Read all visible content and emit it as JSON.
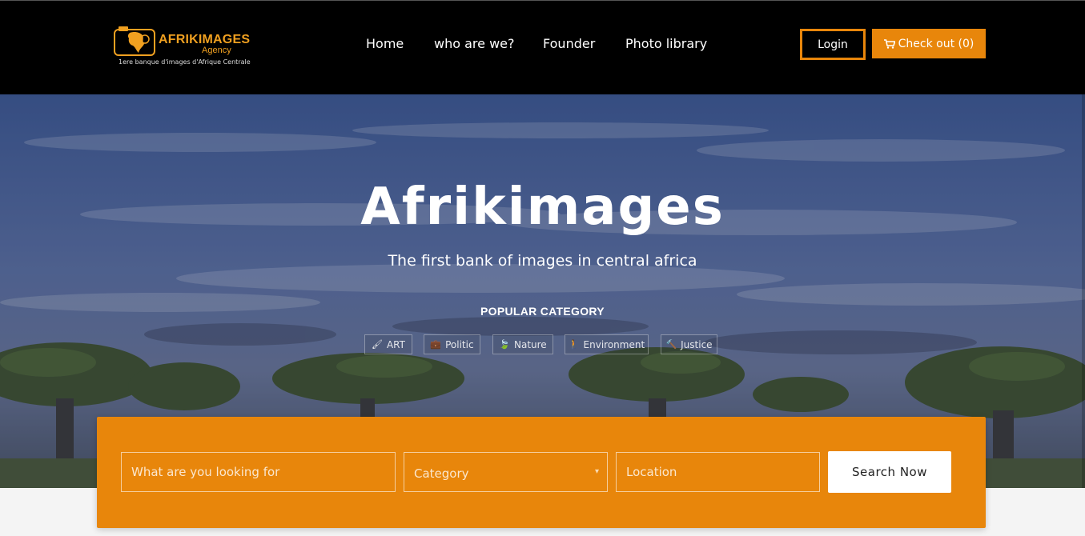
{
  "header": {
    "logo": {
      "title": "AFRIKIMAGES",
      "subtitle": "Agency",
      "tagline": "1ere banque d'images d'Afrique Centrale"
    },
    "nav": [
      {
        "label": "Home"
      },
      {
        "label": "who are we?"
      },
      {
        "label": "Founder"
      },
      {
        "label": "Photo library"
      }
    ],
    "login_label": "Login",
    "checkout_label": "Check out (0)",
    "accent_color": "#e8860b"
  },
  "hero": {
    "title": "Afrikimages",
    "subtitle": "The first bank of images in central africa",
    "popular_heading": "POPULAR CATEGORY",
    "categories": [
      {
        "label": "ART",
        "icon": "paintbrush-icon"
      },
      {
        "label": "Politic",
        "icon": "briefcase-icon"
      },
      {
        "label": "Nature",
        "icon": "leaf-icon"
      },
      {
        "label": "Environment",
        "icon": "walking-person-icon"
      },
      {
        "label": "Justice",
        "icon": "gavel-icon"
      }
    ]
  },
  "search": {
    "query_placeholder": "What are you looking for",
    "category_placeholder": "Category",
    "location_placeholder": "Location",
    "button_label": "Search Now"
  }
}
